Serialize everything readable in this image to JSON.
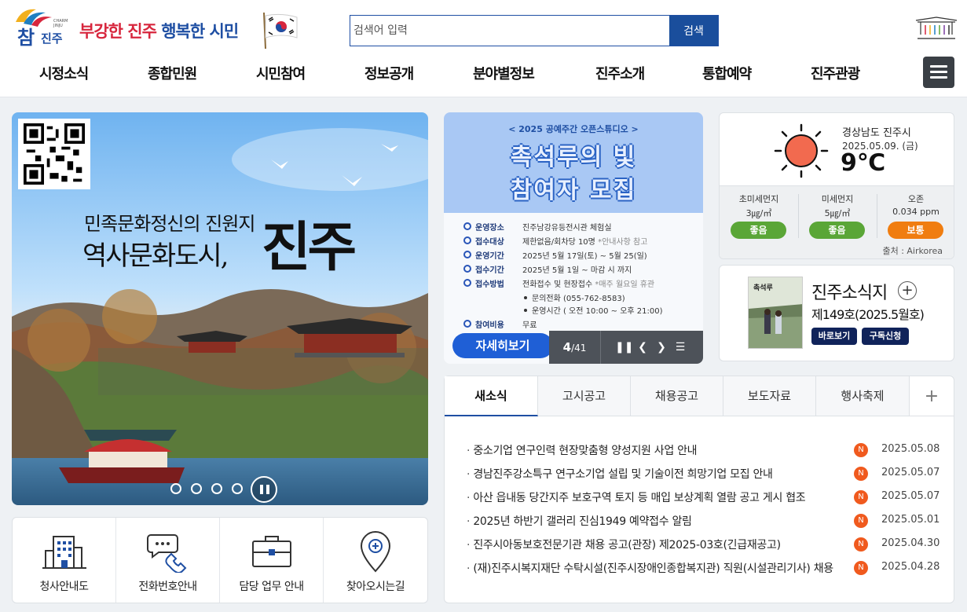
{
  "header": {
    "logo_text": "참진주",
    "slogan_part1": "부강한 진주",
    "slogan_part2": "행복한 시민",
    "search_placeholder": "검색어 입력",
    "search_button": "검색"
  },
  "nav": [
    "시정소식",
    "종합민원",
    "시민참여",
    "정보공개",
    "분야별정보",
    "진주소개",
    "통합예약",
    "진주관광"
  ],
  "hero": {
    "line1": "민족문화정신의 진원지",
    "line2": "역사문화도시,",
    "line3": "진주"
  },
  "quick_links": [
    "청사안내도",
    "전화번호안내",
    "담당 업무 안내",
    "찾아오시는길"
  ],
  "popup": {
    "subtitle": "< 2025 공예주간 오픈스튜디오 >",
    "title_line1": "촉석루의 빛",
    "title_line2": "참여자 모집",
    "rows": [
      {
        "key": "운영장소",
        "value": "진주남강유등전시관 체험실",
        "note": ""
      },
      {
        "key": "접수대상",
        "value": "제한없음/회차당 10명",
        "note": "*안내사항 참고"
      },
      {
        "key": "운영기간",
        "value": "2025년 5월 17일(토) ~ 5월 25(일)",
        "note": ""
      },
      {
        "key": "접수기간",
        "value": "2025년 5월 1일 ~ 마감 시 까지",
        "note": ""
      },
      {
        "key": "접수방법",
        "value": "전화접수 및 현장접수",
        "note": "*매주 월요일 휴관"
      },
      {
        "key": "참여비용",
        "value": "무료",
        "note": ""
      }
    ],
    "sub_items": [
      "문의전화 (055-762-8583)",
      "운영시간 ( 오전 10:00 ~ 오후 21:00)"
    ],
    "detail_button": "자세히보기",
    "page_current": "4",
    "page_total": "/41"
  },
  "weather": {
    "location": "경상남도 진주시",
    "date": "2025.05.09. (금)",
    "temp": "9℃",
    "dust": [
      {
        "name": "초미세먼지",
        "value": "3㎍/㎥",
        "grade": "좋음",
        "color": "#5aa637"
      },
      {
        "name": "미세먼지",
        "value": "5㎍/㎥",
        "grade": "좋음",
        "color": "#5aa637"
      },
      {
        "name": "오존",
        "value": "0.034 ppm",
        "grade": "보통",
        "color": "#f07d10"
      }
    ],
    "source": "출처 : Airkorea"
  },
  "magazine": {
    "title": "진주소식지",
    "issue": "제149호(2025.5월호)",
    "btn_view": "바로보기",
    "btn_subscribe": "구독신청",
    "cover_text": "촉석루"
  },
  "news": {
    "tabs": [
      "새소식",
      "고시공고",
      "채용공고",
      "보도자료",
      "행사축제"
    ],
    "new_badge": "N",
    "items": [
      {
        "title": "중소기업 연구인력 현장맞춤형 양성지원 사업 안내",
        "date": "2025.05.08"
      },
      {
        "title": "경남진주강소특구 연구소기업 설립 및 기술이전 희망기업 모집 안내",
        "date": "2025.05.07"
      },
      {
        "title": "아산 읍내동 당간지주 보호구역 토지 등 매입 보상계획 열람 공고 게시 협조",
        "date": "2025.05.07"
      },
      {
        "title": "2025년 하반기 갤러리 진심1949 예약접수 알림",
        "date": "2025.05.01"
      },
      {
        "title": "진주시아동보호전문기관 채용 공고(관장) 제2025-03호(긴급재공고)",
        "date": "2025.04.30"
      },
      {
        "title": "(재)진주시복지재단 수탁시설(진주시장애인종합복지관) 직원(시설관리기사) 채용",
        "date": "2025.04.28"
      }
    ]
  }
}
